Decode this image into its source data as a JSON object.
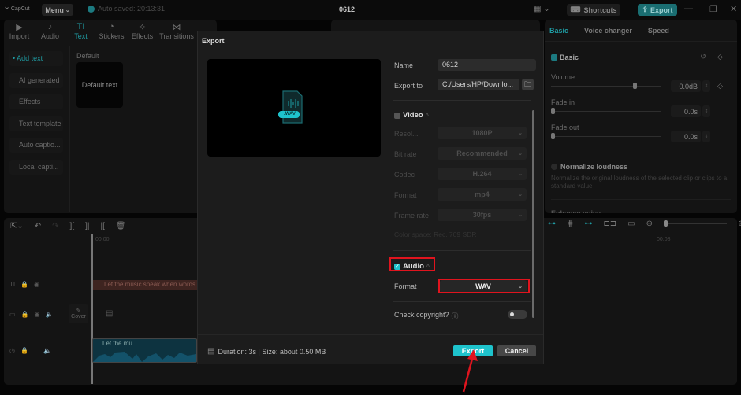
{
  "app": {
    "logo": "CapCut",
    "menu_label": "Menu",
    "autosave": "Auto saved: 20:13:31",
    "project_title": "0612",
    "shortcuts_label": "Shortcuts",
    "export_label": "Export"
  },
  "media_tabs": [
    {
      "label": "Import",
      "icon": "▶"
    },
    {
      "label": "Audio",
      "icon": "♪"
    },
    {
      "label": "Text",
      "icon": "TI",
      "active": true
    },
    {
      "label": "Stickers",
      "icon": "◔"
    },
    {
      "label": "Effects",
      "icon": "✧"
    },
    {
      "label": "Transitions",
      "icon": "⋈"
    }
  ],
  "text_sidebar": [
    {
      "label": "• Add text",
      "active": true
    },
    {
      "label": "AI generated"
    },
    {
      "label": "Effects"
    },
    {
      "label": "Text template"
    },
    {
      "label": "Auto captio..."
    },
    {
      "label": "Local capti..."
    }
  ],
  "text_panel": {
    "section_label": "Default",
    "card_label": "Default text"
  },
  "right_panel": {
    "tabs": [
      "Basic",
      "Voice changer",
      "Speed"
    ],
    "basic_label": "Basic",
    "volume_label": "Volume",
    "volume_value": "0.0dB",
    "volume_level": 0.75,
    "fade_in_label": "Fade in",
    "fade_in_value": "0.0s",
    "fade_out_label": "Fade out",
    "fade_out_value": "0.0s",
    "normalize_label": "Normalize loudness",
    "normalize_desc": "Normalize the original loudness of the selected clip or clips to a standard value",
    "enhance_label": "Enhance voice"
  },
  "timeline": {
    "start_time": "00:00",
    "mark_time": "00:08",
    "text_clip": "Let the music speak when words",
    "audio_clip": "Let the mu...",
    "cover_label": "Cover"
  },
  "export_dialog": {
    "title": "Export",
    "preview_badge": ".WAV",
    "name_label": "Name",
    "name_value": "0612",
    "export_to_label": "Export to",
    "export_to_value": "C:/Users/HP/Downlo...",
    "video": {
      "label": "Video",
      "checked": false,
      "resolution_label": "Resol...",
      "resolution_value": "1080P",
      "bitrate_label": "Bit rate",
      "bitrate_value": "Recommended",
      "codec_label": "Codec",
      "codec_value": "H.264",
      "format_label": "Format",
      "format_value": "mp4",
      "framerate_label": "Frame rate",
      "framerate_value": "30fps",
      "color_space": "Color space: Rec. 709 SDR"
    },
    "audio": {
      "label": "Audio",
      "checked": true,
      "format_label": "Format",
      "format_value": "WAV"
    },
    "copyright_label": "Check copyright?",
    "copyright_enabled": false,
    "footer_info": "Duration: 3s | Size: about 0.50 MB",
    "export_button": "Export",
    "cancel_button": "Cancel"
  },
  "colors": {
    "accent": "#1ec3cc",
    "highlight_box": "#e0141e"
  }
}
